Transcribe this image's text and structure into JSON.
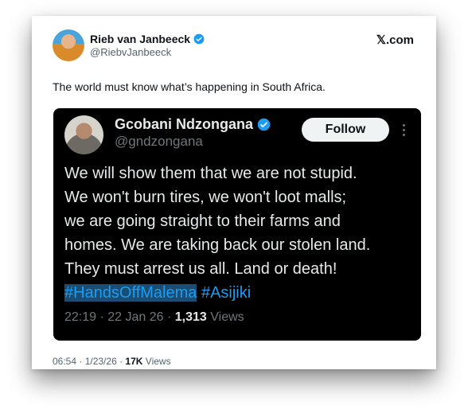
{
  "tweet": {
    "author_name": "Rieb van Janbeeck",
    "author_handle": "@RiebvJanbeeck",
    "brand": "𝕏.com",
    "text": "The world must know what’s happening in South Africa.",
    "time": "06:54",
    "date": "1/23/26",
    "views_count": "17K",
    "views_label": "Views",
    "sep": " · "
  },
  "quote": {
    "author_name": "Gcobani Ndzongana",
    "author_handle": "@gndzongana",
    "follow_label": "Follow",
    "lines": [
      "We will show them that we are not stupid.",
      "We won't burn tires, we won't loot malls;",
      "we are going straight to their farms and",
      "homes. We are taking back our stolen land.",
      "They must arrest us all. Land or death!"
    ],
    "hashtags": [
      "#HandsOffMalema",
      "#Asijiki"
    ],
    "time": "22:19",
    "date": "22 Jan 26",
    "views_count": "1,313",
    "views_label": "Views",
    "sep": " · "
  },
  "colors": {
    "verified": "#1d9bf0",
    "quote_bg": "#000000",
    "hashtag": "#1d9bf0"
  },
  "icons": {
    "verified": "verified-badge-icon",
    "more": "more-options-icon"
  }
}
